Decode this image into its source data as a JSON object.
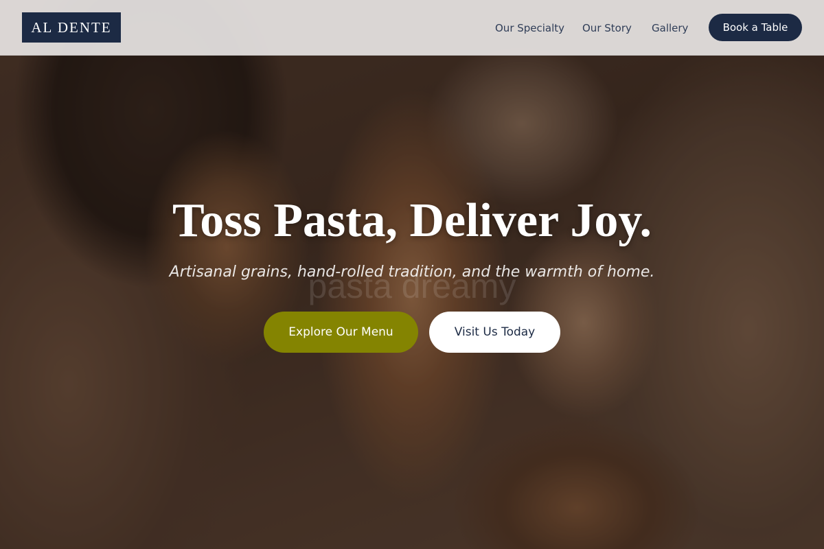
{
  "header": {
    "logo_text": "AL DENTE",
    "nav": [
      {
        "label": "Our Specialty"
      },
      {
        "label": "Our Story"
      },
      {
        "label": "Gallery"
      }
    ],
    "cta_label": "Book a Table"
  },
  "hero": {
    "headline": "Toss Pasta, Deliver Joy.",
    "subtitle": "Artisanal grains, hand-rolled tradition, and the warmth of home.",
    "ghost_text": "pasta dreamy",
    "primary_button": "Explore Our Menu",
    "secondary_button": "Visit Us Today"
  },
  "colors": {
    "brand_navy": "#1c2a44",
    "accent_olive": "#848401",
    "header_bg": "#e8e5e4"
  }
}
